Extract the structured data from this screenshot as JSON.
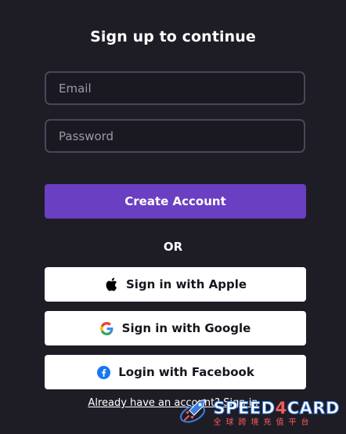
{
  "form": {
    "title": "Sign up to continue",
    "email_placeholder": "Email",
    "password_placeholder": "Password",
    "create_label": "Create Account",
    "or_label": "OR",
    "apple_label": "Sign in with Apple",
    "google_label": "Sign in with Google",
    "facebook_label": "Login with Facebook",
    "signin_link": "Already have an account? Sign in"
  },
  "colors": {
    "background": "#1e1d26",
    "primary": "#6a3fc1",
    "field_border": "#46475a",
    "facebook": "#1877f2"
  },
  "watermark": {
    "brand_prefix": "SPEED",
    "brand_digit": "4",
    "brand_suffix": "CARD",
    "subtitle": "全球跨境充值平台"
  }
}
